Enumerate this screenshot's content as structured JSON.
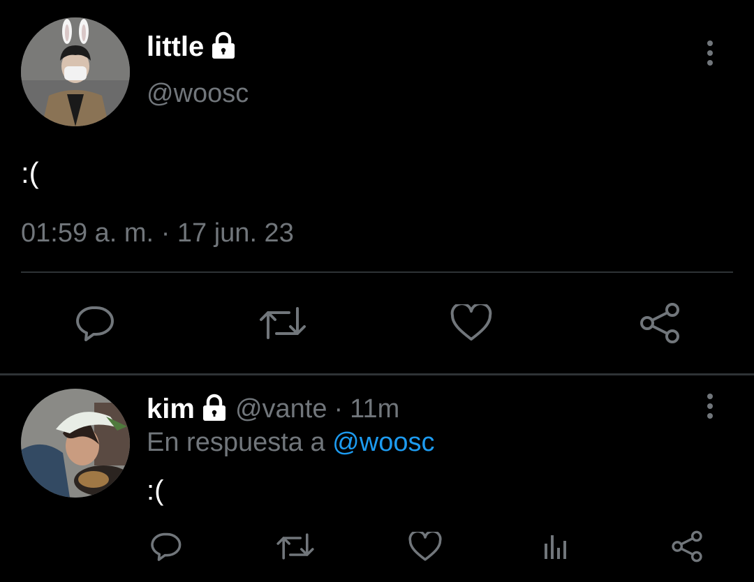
{
  "tweet": {
    "author_name": "little",
    "author_handle": "@woosc",
    "protected_icon": "lock-icon",
    "text": ":(",
    "time": "01:59 a. m.",
    "separator": "·",
    "date": "17 jun. 23",
    "actions": [
      "reply-icon",
      "retweet-icon",
      "like-icon",
      "share-icon"
    ],
    "more_icon": "more-vertical-icon"
  },
  "reply": {
    "author_name": "kim",
    "author_handle": "@vante",
    "separator": "·",
    "age": "11m",
    "in_reply_prefix": "En respuesta a",
    "in_reply_handle": "@woosc",
    "text": ":(",
    "actions": [
      "reply-icon",
      "retweet-icon",
      "like-icon",
      "analytics-icon",
      "share-icon"
    ],
    "more_icon": "more-vertical-icon"
  },
  "colors": {
    "background": "#000000",
    "text": "#e7e9ea",
    "muted": "#71767b",
    "link": "#1d9bf0",
    "divider": "#2f3336"
  }
}
